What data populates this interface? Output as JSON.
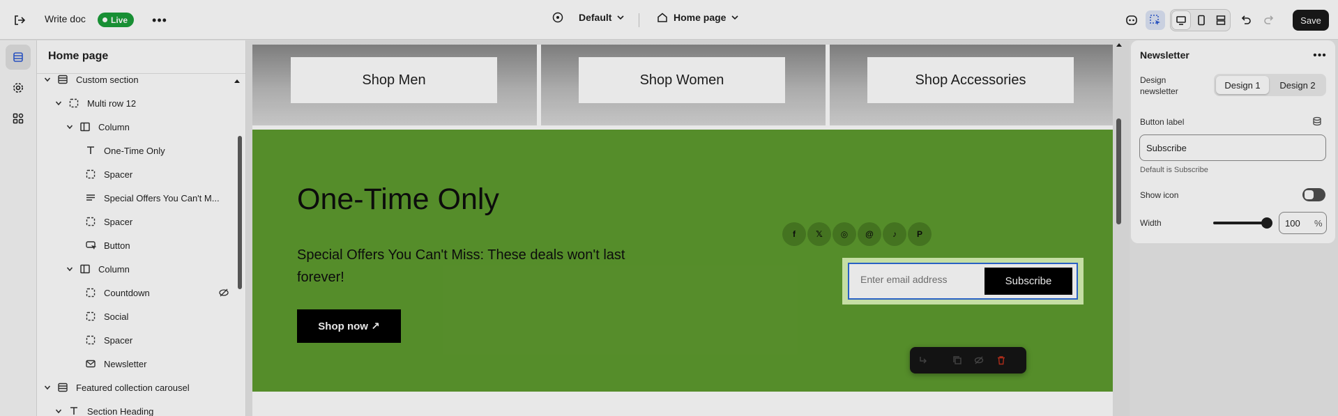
{
  "topbar": {
    "doc_title": "Write doc",
    "live_label": "Live",
    "theme": "Default",
    "page": "Home page",
    "save_label": "Save"
  },
  "sidebar": {
    "title": "Home page",
    "items": [
      {
        "label": "Custom section",
        "icon": "section-icon"
      },
      {
        "label": "Multi row 12",
        "icon": "dashed-box-icon"
      },
      {
        "label": "Column",
        "icon": "column-icon"
      },
      {
        "label": "One-Time Only",
        "icon": "text-icon"
      },
      {
        "label": "Spacer",
        "icon": "dashed-box-icon"
      },
      {
        "label": "Special Offers You Can't M...",
        "icon": "paragraph-icon"
      },
      {
        "label": "Spacer",
        "icon": "dashed-box-icon"
      },
      {
        "label": "Button",
        "icon": "button-icon"
      },
      {
        "label": "Column",
        "icon": "column-icon"
      },
      {
        "label": "Countdown",
        "icon": "dashed-box-icon"
      },
      {
        "label": "Social",
        "icon": "dashed-box-icon"
      },
      {
        "label": "Spacer",
        "icon": "dashed-box-icon"
      },
      {
        "label": "Newsletter",
        "icon": "mail-icon"
      },
      {
        "label": "Featured collection carousel",
        "icon": "section-icon"
      },
      {
        "label": "Section Heading",
        "icon": "text-icon"
      }
    ]
  },
  "canvas": {
    "categories": [
      "Shop Men",
      "Shop Women",
      "Shop Accessories"
    ],
    "promo": {
      "title": "One-Time Only",
      "text": "Special Offers You Can't Miss: These deals won't last forever!",
      "button": "Shop now ↗",
      "background": "#5e9b2f"
    },
    "social_icons": [
      "facebook-icon",
      "x-icon",
      "instagram-icon",
      "threads-icon",
      "tiktok-icon",
      "pinterest-icon"
    ],
    "social_glyphs": [
      "f",
      "𝕏",
      "◎",
      "@",
      "♪",
      "P"
    ],
    "newsletter": {
      "placeholder": "Enter email address",
      "button": "Subscribe"
    }
  },
  "panel": {
    "title": "Newsletter",
    "design_label": "Design newsletter",
    "design_options": [
      "Design 1",
      "Design 2"
    ],
    "design_selected": "Design 1",
    "button_label_title": "Button label",
    "button_label_value": "Subscribe",
    "button_label_help": "Default is Subscribe",
    "show_icon_label": "Show icon",
    "show_icon": false,
    "width_label": "Width",
    "width_value": "100",
    "width_unit": "%"
  },
  "colors": {
    "accent_live": "#1b9e3a",
    "selection_outline": "#2e6bd8"
  }
}
